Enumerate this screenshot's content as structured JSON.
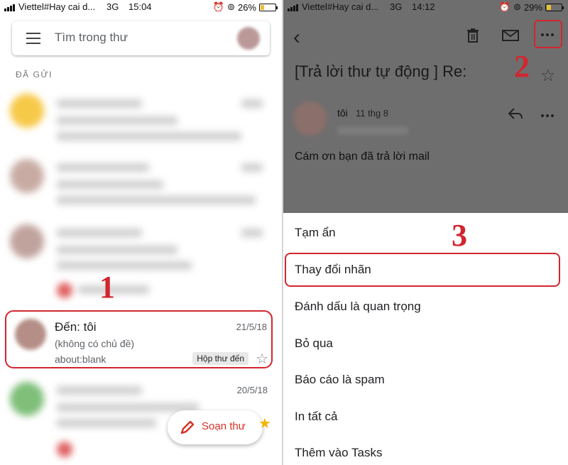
{
  "left": {
    "status": {
      "carrier": "Viettel#Hay cai d...",
      "network": "3G",
      "time": "15:04",
      "battery": "26%",
      "battery_level": 0.26
    },
    "search": {
      "placeholder": "Tìm trong thư"
    },
    "section_label": "ĐÃ GỬI",
    "highlighted_email": {
      "to": "Đến: tôi",
      "date": "21/5/18",
      "subject": "(không có chủ đề)",
      "snippet": "about:blank",
      "label": "Hộp thư đến"
    },
    "next_email_date": "20/5/18",
    "compose_label": "Soạn thư",
    "annotation": "1"
  },
  "right": {
    "status": {
      "carrier": "Viettel#Hay cai d...",
      "network": "3G",
      "time": "14:12",
      "battery": "29%",
      "battery_level": 0.29
    },
    "subject": "[Trả lời thư tự động ] Re:",
    "sender": "tôi",
    "sender_date": "11 thg 8",
    "body": "Cám ơn bạn đã trả lời mail",
    "annotation_more": "2",
    "annotation_menu": "3",
    "menu_items": [
      "Tạm ẩn",
      "Thay đổi nhãn",
      "Đánh dấu là quan trọng",
      "Bỏ qua",
      "Báo cáo là spam",
      "In tất cả",
      "Thêm vào Tasks"
    ]
  },
  "colors": {
    "highlight": "#d2262f",
    "compose": "#d93025",
    "star_active": "#f4b400"
  }
}
